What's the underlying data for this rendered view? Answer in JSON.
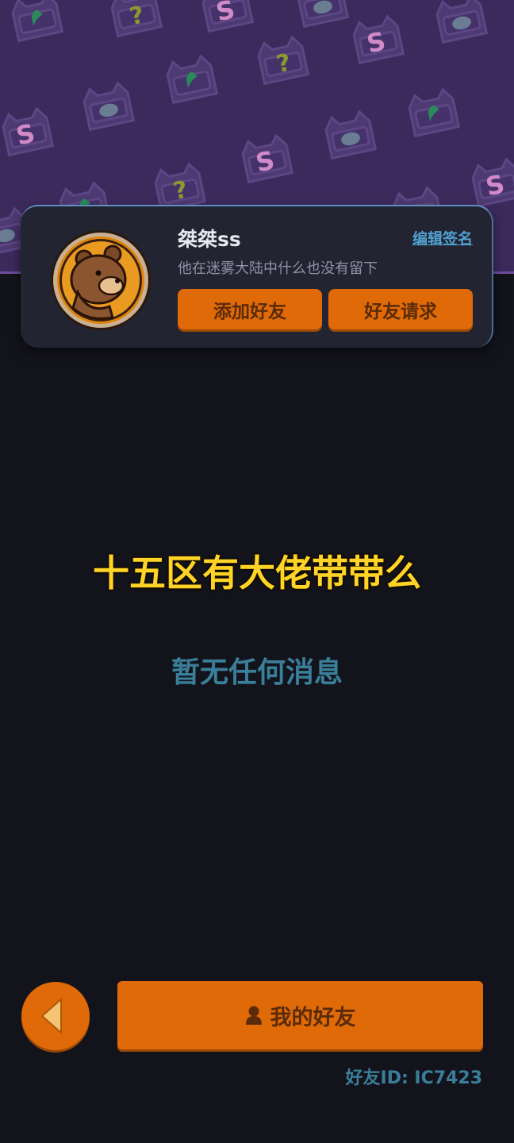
{
  "profile": {
    "username": "桀桀ss",
    "edit_signature": "编辑签名",
    "signature": "他在迷雾大陆中什么也没有留下",
    "add_friend": "添加好友",
    "friend_requests": "好友请求"
  },
  "caption": "十五区有大佬带带么",
  "messages": {
    "empty": "暂无任何消息"
  },
  "footer": {
    "my_friends": "我的好友",
    "friend_id": "好友ID: IC7423"
  },
  "icons": {
    "back": "chevron-left-icon",
    "person": "person-icon",
    "avatar": "bear-avatar"
  },
  "colors": {
    "accent_orange": "#e06a08",
    "header_purple": "#3c2a5c",
    "background": "#13131b",
    "teal_text": "#3a7f9a",
    "caption_yellow": "#ffd426"
  }
}
